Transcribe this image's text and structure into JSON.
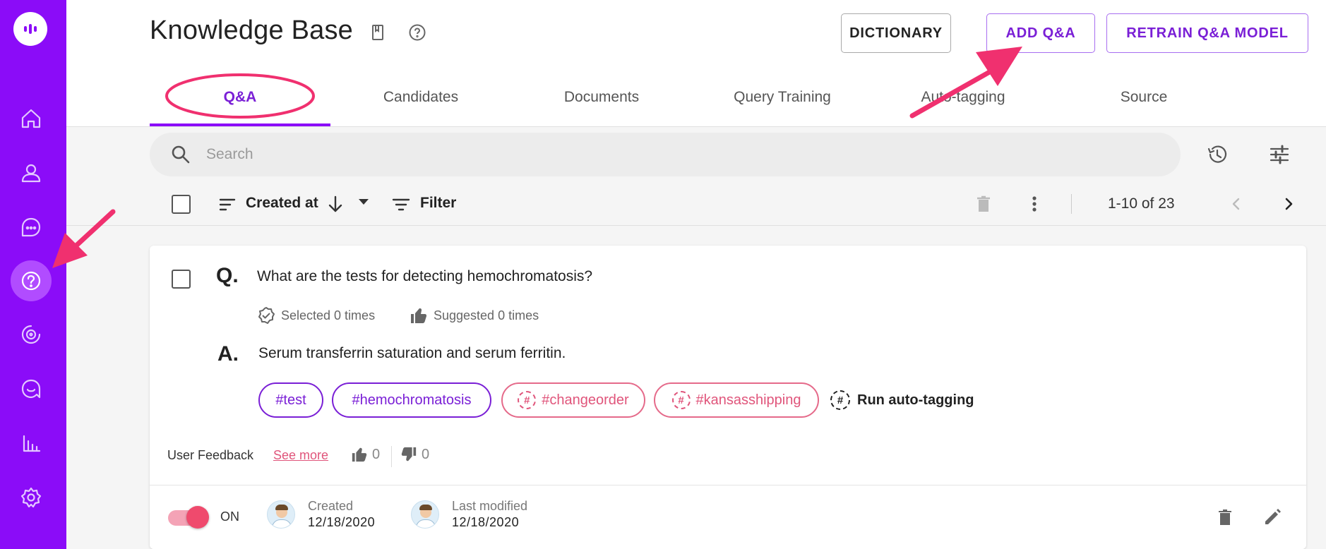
{
  "page": {
    "title": "Knowledge Base",
    "buttons": {
      "dictionary": "DICTIONARY",
      "add_qa": "ADD Q&A",
      "retrain": "RETRAIN Q&A MODEL"
    }
  },
  "tabs": [
    {
      "label": "Q&A",
      "active": true
    },
    {
      "label": "Candidates",
      "active": false
    },
    {
      "label": "Documents",
      "active": false
    },
    {
      "label": "Query Training",
      "active": false
    },
    {
      "label": "Auto-tagging",
      "active": false
    },
    {
      "label": "Source",
      "active": false
    }
  ],
  "search": {
    "placeholder": "Search"
  },
  "toolbar": {
    "sort_label": "Created at",
    "filter_label": "Filter",
    "pagination": "1-10 of 23"
  },
  "sidebar": {
    "items": [
      "home-icon",
      "user-icon",
      "chat-icon",
      "qa-help-icon",
      "target-icon",
      "message-icon",
      "analytics-icon",
      "settings-icon"
    ],
    "active": "qa-help-icon"
  },
  "qa_item": {
    "q_letter": "Q.",
    "question": "What are the tests for detecting hemochromatosis?",
    "selected": "Selected 0 times",
    "suggested": "Suggested 0 times",
    "a_letter": "A.",
    "answer": "Serum transferrin saturation and serum ferritin.",
    "tags": [
      {
        "label": "#test",
        "type": "manual"
      },
      {
        "label": "#hemochromatosis",
        "type": "manual"
      },
      {
        "label": "#changeorder",
        "type": "auto"
      },
      {
        "label": "#kansasshipping",
        "type": "auto"
      }
    ],
    "run_auto_tagging": "Run auto-tagging",
    "feedback_label": "User Feedback",
    "see_more": "See more",
    "thumbs_up": "0",
    "thumbs_down": "0",
    "toggle_label": "ON",
    "created_label": "Created",
    "created_date": "12/18/2020",
    "modified_label": "Last modified",
    "modified_date": "12/18/2020"
  },
  "colors": {
    "sidebar": "#8b0cf8",
    "accent": "#7a1fd6",
    "auto_tag": "#e0557b",
    "annotation": "#f0306f"
  }
}
